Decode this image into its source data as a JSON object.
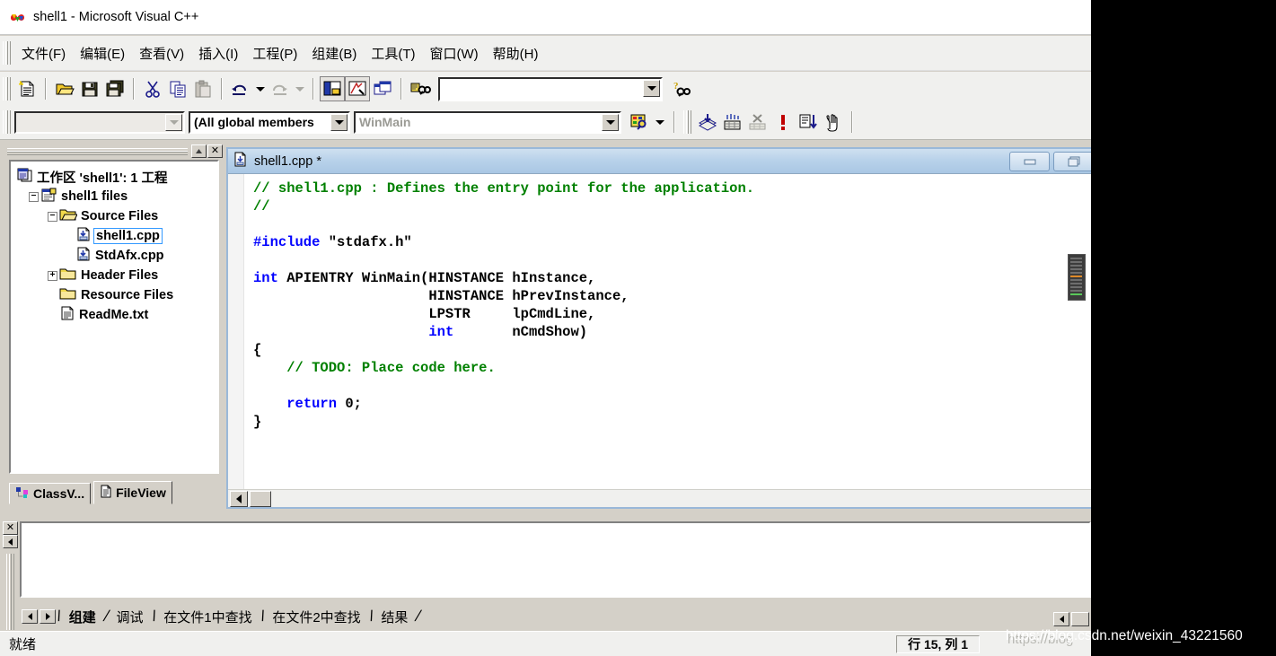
{
  "window": {
    "title": "shell1 - Microsoft Visual C++",
    "app_icon": "visualcpp-logo-icon"
  },
  "menubar": {
    "items": [
      {
        "label": "文件(F)",
        "name": "menu-file"
      },
      {
        "label": "编辑(E)",
        "name": "menu-edit"
      },
      {
        "label": "查看(V)",
        "name": "menu-view"
      },
      {
        "label": "插入(I)",
        "name": "menu-insert"
      },
      {
        "label": "工程(P)",
        "name": "menu-project"
      },
      {
        "label": "组建(B)",
        "name": "menu-build"
      },
      {
        "label": "工具(T)",
        "name": "menu-tools"
      },
      {
        "label": "窗口(W)",
        "name": "menu-window"
      },
      {
        "label": "帮助(H)",
        "name": "menu-help"
      }
    ]
  },
  "toolbar_standard": {
    "buttons": [
      "new-file-icon",
      "open-file-icon",
      "save-icon",
      "save-all-icon",
      "cut-icon",
      "copy-icon",
      "paste-icon",
      "undo-icon",
      "undo-dropdown-icon",
      "redo-icon",
      "redo-dropdown-icon",
      "workspace-panel-icon",
      "output-panel-icon",
      "window-list-icon",
      "find-in-files-icon"
    ],
    "find_box": {
      "value": "",
      "placeholder": ""
    },
    "search_help_icon": "find-help-icon"
  },
  "toolbar_wizardbar": {
    "class_combo": {
      "value": "",
      "name": "wizardbar-class-combo"
    },
    "members_combo": {
      "value": "(All global members",
      "name": "wizardbar-filter-combo"
    },
    "function_combo": {
      "value": "WinMain",
      "name": "wizardbar-function-combo"
    },
    "wizard_icon": "wizard-action-icon",
    "build_buttons": [
      "compile-icon",
      "build-icon",
      "stop-build-icon",
      "execute-program-icon",
      "go-debug-icon",
      "insert-breakpoint-icon"
    ]
  },
  "workspace": {
    "panel_buttons": [
      "minimize-panel-icon",
      "close-panel-icon"
    ],
    "tree": [
      {
        "label": "工作区 'shell1': 1 工程",
        "icon": "workspace-icon",
        "indent": 0,
        "toggle": "none",
        "selected": false
      },
      {
        "label": "shell1 files",
        "icon": "project-icon",
        "indent": 1,
        "toggle": "minus",
        "selected": false
      },
      {
        "label": "Source Files",
        "icon": "folder-open-icon",
        "indent": 2,
        "toggle": "minus",
        "selected": false
      },
      {
        "label": "shell1.cpp",
        "icon": "cpp-file-icon",
        "indent": 3,
        "toggle": "none",
        "selected": true
      },
      {
        "label": "StdAfx.cpp",
        "icon": "cpp-file-icon",
        "indent": 3,
        "toggle": "none",
        "selected": false
      },
      {
        "label": "Header Files",
        "icon": "folder-icon",
        "indent": 2,
        "toggle": "plus",
        "selected": false
      },
      {
        "label": "Resource Files",
        "icon": "folder-icon",
        "indent": 2,
        "toggle": "none",
        "selected": false
      },
      {
        "label": "ReadMe.txt",
        "icon": "text-file-icon",
        "indent": 2,
        "toggle": "none",
        "selected": false
      }
    ],
    "tabs": [
      {
        "label": "ClassV...",
        "icon": "classview-icon",
        "active": false,
        "name": "tab-classview"
      },
      {
        "label": "FileView",
        "icon": "fileview-icon",
        "active": true,
        "name": "tab-fileview"
      }
    ]
  },
  "editor": {
    "tab_title": "shell1.cpp *",
    "doc_icon": "source-document-icon",
    "window_buttons": [
      "minimize-icon",
      "restore-icon"
    ],
    "lines": [
      [
        {
          "t": "// shell1.cpp : Defines the entry point for the application.",
          "c": "comment"
        }
      ],
      [
        {
          "t": "//",
          "c": "comment"
        }
      ],
      [
        {
          "t": "",
          "c": "plain"
        }
      ],
      [
        {
          "t": "#include",
          "c": "pre"
        },
        {
          "t": " \"stdafx.h\"",
          "c": "plain"
        }
      ],
      [
        {
          "t": "",
          "c": "plain"
        }
      ],
      [
        {
          "t": "int",
          "c": "kw"
        },
        {
          "t": " APIENTRY WinMain(HINSTANCE hInstance,",
          "c": "plain"
        }
      ],
      [
        {
          "t": "                     HINSTANCE hPrevInstance,",
          "c": "plain"
        }
      ],
      [
        {
          "t": "                     LPSTR     lpCmdLine,",
          "c": "plain"
        }
      ],
      [
        {
          "t": "                     ",
          "c": "plain"
        },
        {
          "t": "int",
          "c": "kw"
        },
        {
          "t": "       nCmdShow)",
          "c": "plain"
        }
      ],
      [
        {
          "t": "{",
          "c": "plain"
        }
      ],
      [
        {
          "t": "    ",
          "c": "plain"
        },
        {
          "t": "// TODO: Place code here.",
          "c": "comment"
        }
      ],
      [
        {
          "t": "",
          "c": "plain"
        }
      ],
      [
        {
          "t": "    ",
          "c": "plain"
        },
        {
          "t": "return",
          "c": "kw"
        },
        {
          "t": " 0;",
          "c": "plain"
        }
      ],
      [
        {
          "t": "}",
          "c": "plain"
        }
      ]
    ],
    "colors": {
      "comment": "#008000",
      "keyword": "#0000ff",
      "preprocessor": "#0000ff",
      "plain": "#000000"
    }
  },
  "output_pane": {
    "gutter_buttons": [
      "close-output-icon",
      "scroll-left-icon"
    ],
    "content": "",
    "tabs": [
      {
        "label": "组建",
        "active": true,
        "name": "output-tab-build"
      },
      {
        "label": "调试",
        "active": false,
        "name": "output-tab-debug"
      },
      {
        "label": "在文件1中查找",
        "active": false,
        "name": "output-tab-find1"
      },
      {
        "label": "在文件2中查找",
        "active": false,
        "name": "output-tab-find2"
      },
      {
        "label": "结果",
        "active": false,
        "name": "output-tab-results"
      }
    ]
  },
  "statusbar": {
    "message": "就绪",
    "position": "行 15, 列 1"
  },
  "watermark": {
    "text": "https://blog.csdn.net/weixin_43221560"
  }
}
